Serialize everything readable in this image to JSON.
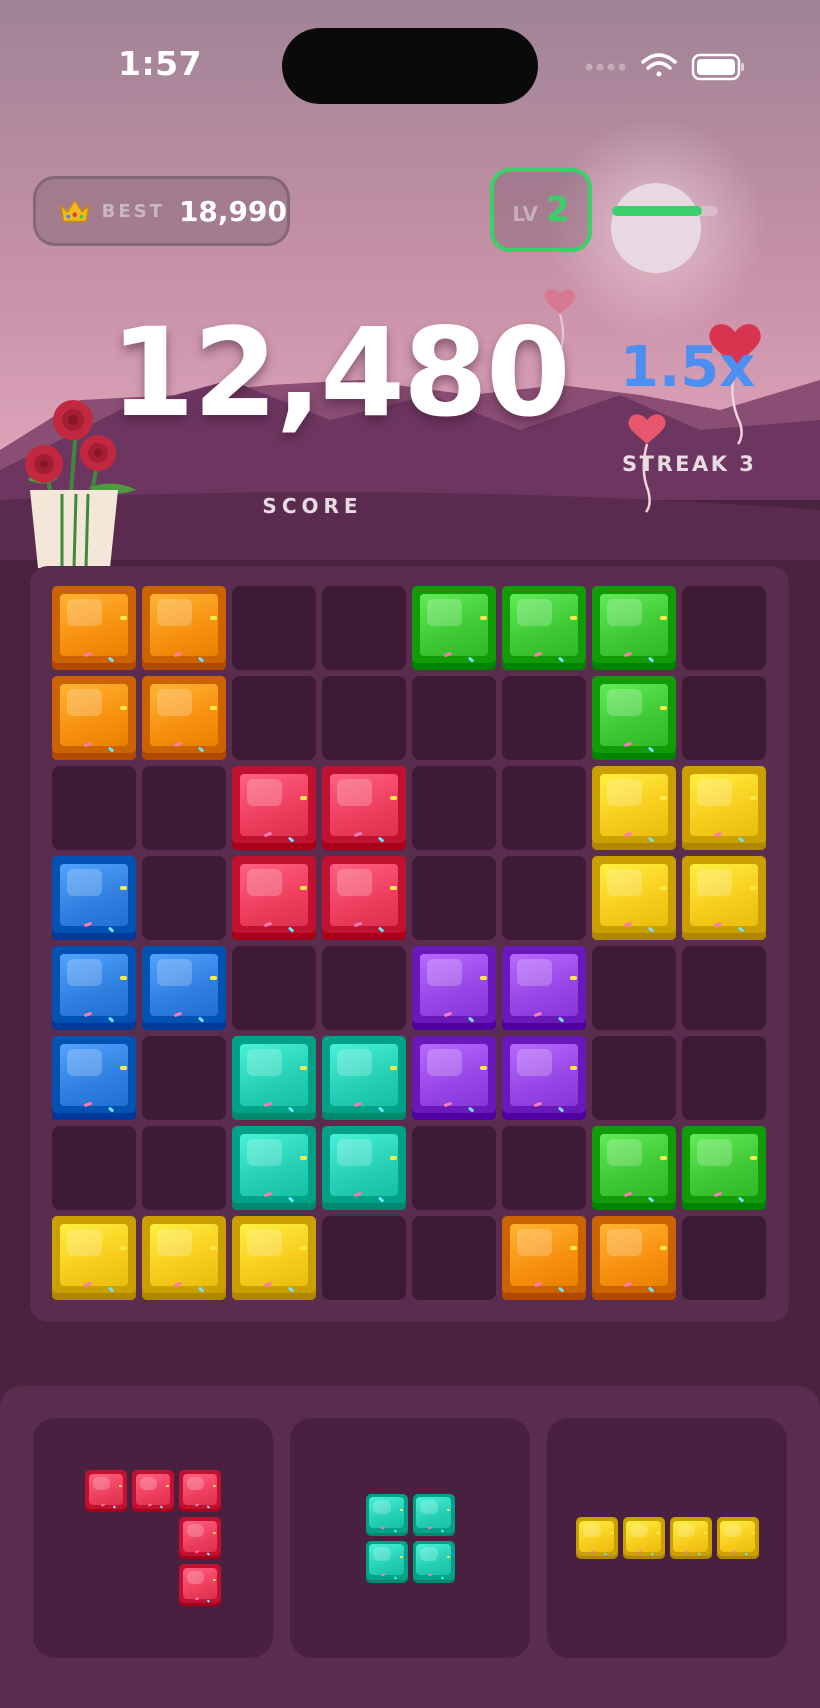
{
  "status_bar": {
    "time": "1:57"
  },
  "header": {
    "best_label": "BEST",
    "best_value": "18,990",
    "level_prefix": "LV",
    "level": "2",
    "level_progress": 0.85
  },
  "score": {
    "value": "12,480",
    "label": "SCORE"
  },
  "combo": {
    "multiplier": "1.5x",
    "streak": "STREAK 3"
  },
  "colors": {
    "orange": "#f7900f",
    "green": "#3ec934",
    "red": "#ee3e5e",
    "yellow": "#f7cc1c",
    "blue": "#2f7fe0",
    "purple": "#9646e6",
    "teal": "#25cfb4",
    "empty": "#3d1a35",
    "accent_green": "#3ad16a",
    "multiplier_blue": "#4d8ff0"
  },
  "board": {
    "rows": [
      [
        "orange",
        "orange",
        null,
        null,
        "green",
        "green",
        "green",
        null
      ],
      [
        "orange",
        "orange",
        null,
        null,
        null,
        null,
        "green",
        null
      ],
      [
        null,
        null,
        "red",
        "red",
        null,
        null,
        "yellow",
        "yellow"
      ],
      [
        "blue",
        null,
        "red",
        "red",
        null,
        null,
        "yellow",
        "yellow"
      ],
      [
        "blue",
        "blue",
        null,
        null,
        "purple",
        "purple",
        null,
        null
      ],
      [
        "blue",
        null,
        "teal",
        "teal",
        "purple",
        "purple",
        null,
        null
      ],
      [
        null,
        null,
        "teal",
        "teal",
        null,
        null,
        "green",
        "green"
      ],
      [
        "yellow",
        "yellow",
        "yellow",
        null,
        null,
        "orange",
        "orange",
        null
      ]
    ]
  },
  "tray": {
    "pieces": [
      {
        "color": "red",
        "cells": [
          [
            0,
            0
          ],
          [
            0,
            1
          ],
          [
            0,
            2
          ],
          [
            1,
            2
          ],
          [
            2,
            2
          ]
        ]
      },
      {
        "color": "teal",
        "cells": [
          [
            0,
            0
          ],
          [
            0,
            1
          ],
          [
            1,
            0
          ],
          [
            1,
            1
          ]
        ]
      },
      {
        "color": "yellow",
        "cells": [
          [
            0,
            0
          ],
          [
            0,
            1
          ],
          [
            0,
            2
          ],
          [
            0,
            3
          ]
        ]
      }
    ]
  },
  "icons": [
    "crown-icon",
    "wifi-icon",
    "battery-icon",
    "signal-dots-icon",
    "rose-bouquet-icon",
    "heart-balloon-icon",
    "moon-icon"
  ]
}
